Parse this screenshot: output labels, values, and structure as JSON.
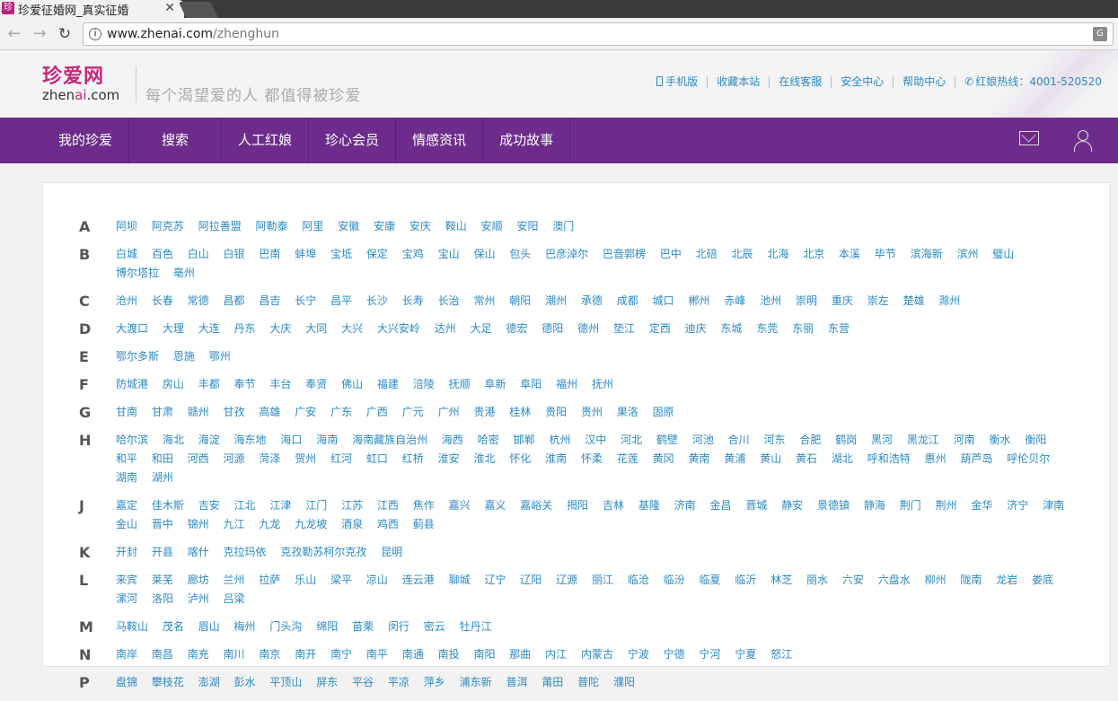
{
  "browser": {
    "tab_title": "珍爱征婚网_真实征婚",
    "tab_favicon": "珍",
    "url_host": "www.zhenai.com",
    "url_path": "/zhenghun"
  },
  "header": {
    "logo_cn": "珍爱网",
    "logo_en_pre": "zhen",
    "logo_en_ai": "ai",
    "logo_en_post": ".com",
    "slogan": "每个渴望爱的人  都值得被珍爱",
    "links": [
      "手机版",
      "收藏本站",
      "在线客服",
      "安全中心",
      "帮助中心",
      "红娘热线：4001-520520"
    ]
  },
  "nav": {
    "items": [
      "我的珍爱",
      "搜索",
      "人工红娘",
      "珍心会员",
      "情感资讯",
      "成功故事"
    ]
  },
  "city_groups": [
    {
      "letter": "A",
      "cities": [
        "阿坝",
        "阿克苏",
        "阿拉善盟",
        "阿勒泰",
        "阿里",
        "安徽",
        "安康",
        "安庆",
        "鞍山",
        "安顺",
        "安阳",
        "澳门"
      ]
    },
    {
      "letter": "B",
      "cities": [
        "白城",
        "百色",
        "白山",
        "白银",
        "巴南",
        "蚌埠",
        "宝坻",
        "保定",
        "宝鸡",
        "宝山",
        "保山",
        "包头",
        "巴彦淖尔",
        "巴音郭楞",
        "巴中",
        "北碚",
        "北辰",
        "北海",
        "北京",
        "本溪",
        "毕节",
        "滨海新",
        "滨州",
        "璧山",
        "博尔塔拉",
        "亳州"
      ]
    },
    {
      "letter": "C",
      "cities": [
        "沧州",
        "长春",
        "常德",
        "昌都",
        "昌吉",
        "长宁",
        "昌平",
        "长沙",
        "长寿",
        "长治",
        "常州",
        "朝阳",
        "潮州",
        "承德",
        "成都",
        "城口",
        "郴州",
        "赤峰",
        "池州",
        "崇明",
        "重庆",
        "崇左",
        "楚雄",
        "滁州"
      ]
    },
    {
      "letter": "D",
      "cities": [
        "大渡口",
        "大理",
        "大连",
        "丹东",
        "大庆",
        "大同",
        "大兴",
        "大兴安岭",
        "达州",
        "大足",
        "德宏",
        "德阳",
        "德州",
        "垫江",
        "定西",
        "迪庆",
        "东城",
        "东莞",
        "东丽",
        "东营"
      ]
    },
    {
      "letter": "E",
      "cities": [
        "鄂尔多斯",
        "恩施",
        "鄂州"
      ]
    },
    {
      "letter": "F",
      "cities": [
        "防城港",
        "房山",
        "丰都",
        "奉节",
        "丰台",
        "奉贤",
        "佛山",
        "福建",
        "涪陵",
        "抚顺",
        "阜新",
        "阜阳",
        "福州",
        "抚州"
      ]
    },
    {
      "letter": "G",
      "cities": [
        "甘南",
        "甘肃",
        "赣州",
        "甘孜",
        "高雄",
        "广安",
        "广东",
        "广西",
        "广元",
        "广州",
        "贵港",
        "桂林",
        "贵阳",
        "贵州",
        "果洛",
        "固原"
      ]
    },
    {
      "letter": "H",
      "cities": [
        "哈尔滨",
        "海北",
        "海淀",
        "海东地",
        "海口",
        "海南",
        "海南藏族自治州",
        "海西",
        "哈密",
        "邯郸",
        "杭州",
        "汉中",
        "河北",
        "鹤壁",
        "河池",
        "合川",
        "河东",
        "合肥",
        "鹤岗",
        "黑河",
        "黑龙江",
        "河南",
        "衡水",
        "衡阳",
        "和平",
        "和田",
        "河西",
        "河源",
        "菏泽",
        "贺州",
        "红河",
        "虹口",
        "红桥",
        "淮安",
        "淮北",
        "怀化",
        "淮南",
        "怀柔",
        "花莲",
        "黄冈",
        "黄南",
        "黄浦",
        "黄山",
        "黄石",
        "湖北",
        "呼和浩特",
        "惠州",
        "葫芦岛",
        "呼伦贝尔",
        "湖南",
        "湖州"
      ]
    },
    {
      "letter": "J",
      "cities": [
        "嘉定",
        "佳木斯",
        "吉安",
        "江北",
        "江津",
        "江门",
        "江苏",
        "江西",
        "焦作",
        "嘉兴",
        "嘉义",
        "嘉峪关",
        "揭阳",
        "吉林",
        "基隆",
        "济南",
        "金昌",
        "晋城",
        "静安",
        "景德镇",
        "静海",
        "荆门",
        "荆州",
        "金华",
        "济宁",
        "津南",
        "金山",
        "晋中",
        "锦州",
        "九江",
        "九龙",
        "九龙坡",
        "酒泉",
        "鸡西",
        "蓟县"
      ]
    },
    {
      "letter": "K",
      "cities": [
        "开封",
        "开县",
        "喀什",
        "克拉玛依",
        "克孜勒苏柯尔克孜",
        "昆明"
      ]
    },
    {
      "letter": "L",
      "cities": [
        "来宾",
        "莱芜",
        "廊坊",
        "兰州",
        "拉萨",
        "乐山",
        "梁平",
        "凉山",
        "连云港",
        "聊城",
        "辽宁",
        "辽阳",
        "辽源",
        "丽江",
        "临沧",
        "临汾",
        "临夏",
        "临沂",
        "林芝",
        "丽水",
        "六安",
        "六盘水",
        "柳州",
        "陇南",
        "龙岩",
        "娄底",
        "漯河",
        "洛阳",
        "泸州",
        "吕梁"
      ]
    },
    {
      "letter": "M",
      "cities": [
        "马鞍山",
        "茂名",
        "眉山",
        "梅州",
        "门头沟",
        "绵阳",
        "苗栗",
        "闵行",
        "密云",
        "牡丹江"
      ]
    },
    {
      "letter": "N",
      "cities": [
        "南岸",
        "南昌",
        "南充",
        "南川",
        "南京",
        "南开",
        "南宁",
        "南平",
        "南通",
        "南投",
        "南阳",
        "那曲",
        "内江",
        "内蒙古",
        "宁波",
        "宁德",
        "宁河",
        "宁夏",
        "怒江"
      ]
    },
    {
      "letter": "P",
      "cities": [
        "盘锦",
        "攀枝花",
        "澎湖",
        "彭水",
        "平顶山",
        "屏东",
        "平谷",
        "平凉",
        "萍乡",
        "浦东新",
        "普洱",
        "莆田",
        "普陀",
        "濮阳"
      ]
    }
  ]
}
